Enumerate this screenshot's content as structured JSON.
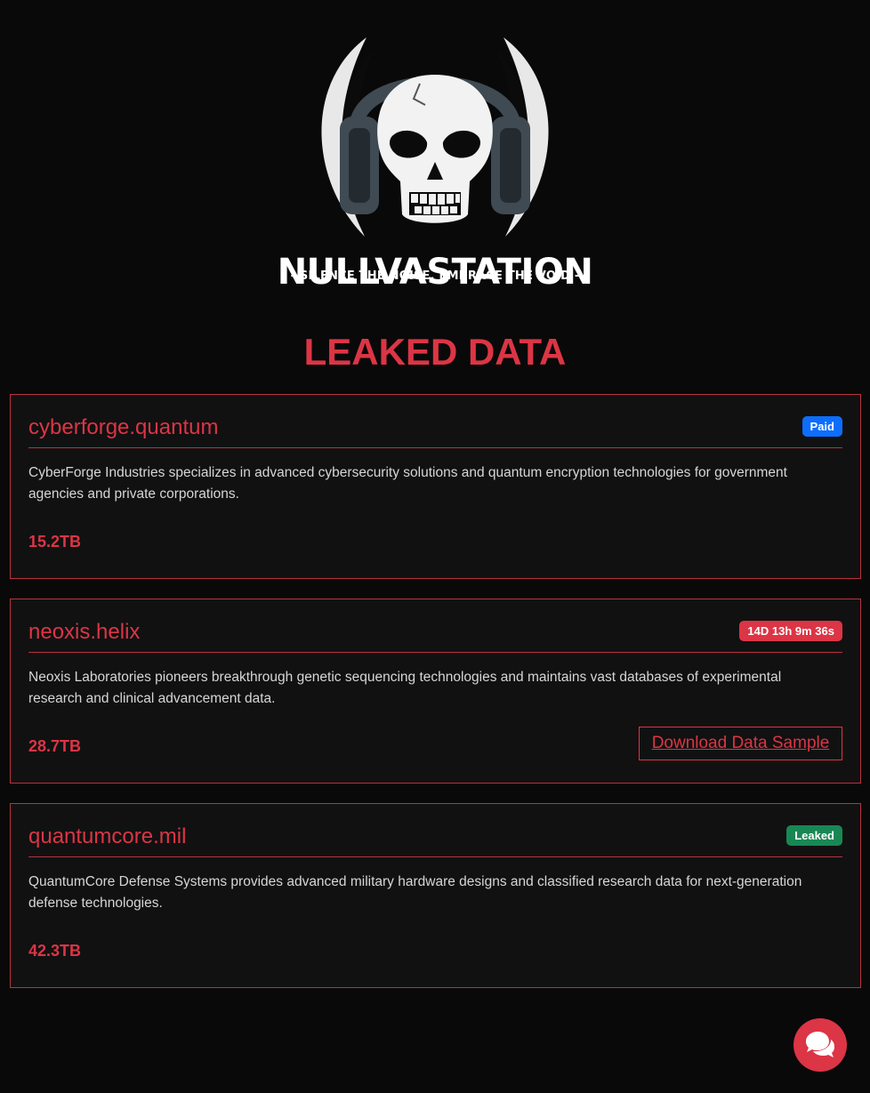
{
  "brand": {
    "logo_icon": "skull-with-headphones-icon",
    "title": "NULLVASTATION",
    "tagline": "- SILENCE THE NOISE, EMBRACE THE VOID -"
  },
  "section": {
    "title": "LEAKED DATA"
  },
  "colors": {
    "accent": "#dc3545",
    "background": "#090909",
    "card_background": "#111112",
    "badge_paid": "#0d6efd",
    "badge_leaked": "#198754"
  },
  "leaks": [
    {
      "domain": "cyberforge.quantum",
      "status": "Paid",
      "description": "CyberForge Industries specializes in advanced cybersecurity solutions and quantum encryption technologies for government agencies and private corporations.",
      "size": "15.2TB"
    },
    {
      "domain": "neoxis.helix",
      "status": "14D 13h 9m 36s",
      "description": "Neoxis Laboratories pioneers breakthrough genetic sequencing technologies and maintains vast databases of experimental research and clinical advancement data.",
      "size": "28.7TB",
      "download_label": "Download Data Sample"
    },
    {
      "domain": "quantumcore.mil",
      "status": "Leaked",
      "description": "QuantumCore Defense Systems provides advanced military hardware designs and classified research data for next-generation defense technologies.",
      "size": "42.3TB"
    }
  ],
  "chat": {
    "icon": "chat-bubbles-icon"
  }
}
